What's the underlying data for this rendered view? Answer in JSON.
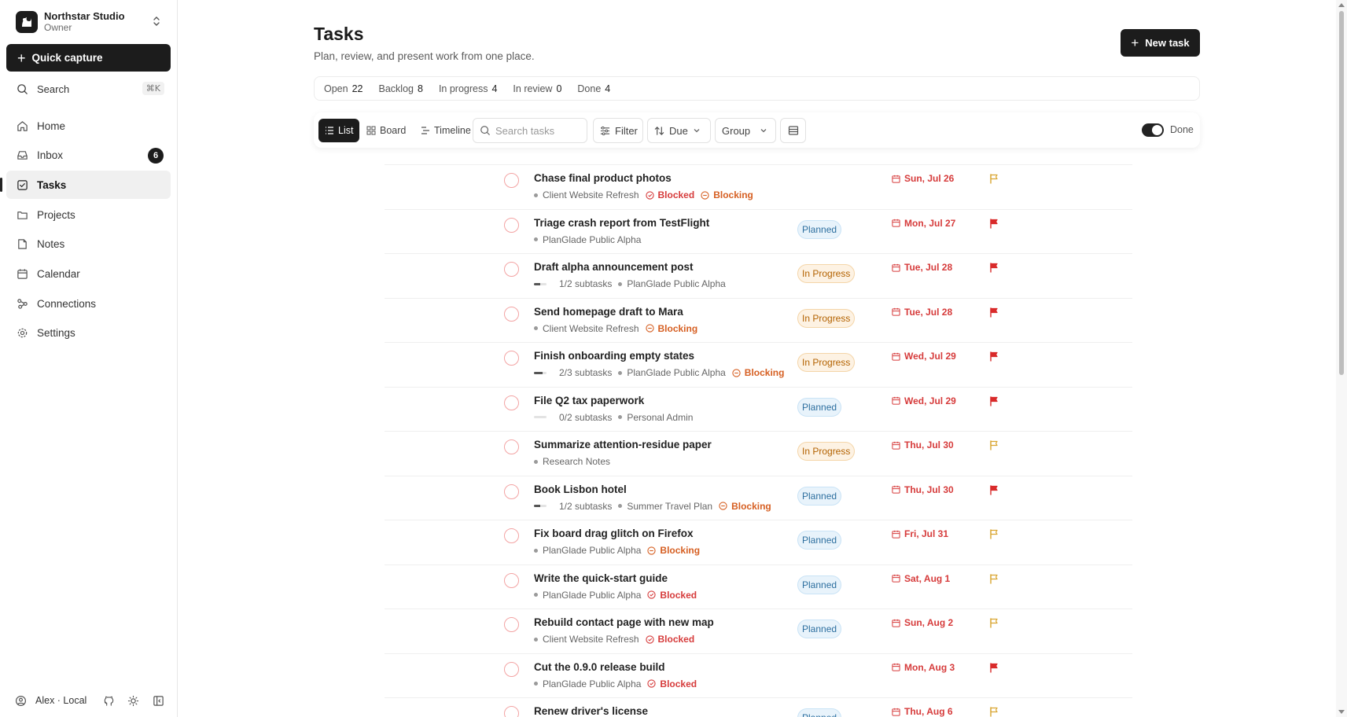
{
  "workspace": {
    "name": "Northstar Studio",
    "role": "Owner"
  },
  "quick_capture": {
    "label": "Quick capture"
  },
  "search": {
    "label": "Search",
    "shortcut": "⌘K"
  },
  "nav": [
    {
      "label": "Home",
      "icon": "home-icon"
    },
    {
      "label": "Inbox",
      "icon": "inbox-icon",
      "badge": "6"
    },
    {
      "label": "Tasks",
      "icon": "tasks-icon",
      "active": true
    },
    {
      "label": "Projects",
      "icon": "folder-icon"
    },
    {
      "label": "Notes",
      "icon": "note-icon"
    },
    {
      "label": "Calendar",
      "icon": "calendar-icon"
    },
    {
      "label": "Connections",
      "icon": "connections-icon"
    },
    {
      "label": "Settings",
      "icon": "gear-icon"
    }
  ],
  "footer": {
    "user": "Alex · Local"
  },
  "page": {
    "title": "Tasks",
    "subtitle": "Plan, review, and present work from one place.",
    "new_task": "New task"
  },
  "stats": [
    {
      "label": "Open",
      "value": "22"
    },
    {
      "label": "Backlog",
      "value": "8"
    },
    {
      "label": "In progress",
      "value": "4"
    },
    {
      "label": "In review",
      "value": "0"
    },
    {
      "label": "Done",
      "value": "4"
    }
  ],
  "toolbar": {
    "views": [
      "List",
      "Board",
      "Timeline"
    ],
    "search_placeholder": "Search tasks",
    "filter": "Filter",
    "sort": "Due",
    "group": "Group",
    "done_toggle": "Done"
  },
  "colors": {
    "accent": "#1c1c1c",
    "overdue": "#d63b3b",
    "blocking": "#d65f22",
    "planned": "#2d6f9f",
    "in_progress": "#b36200",
    "flag_high": "#d92b2b",
    "flag_normal": "#d9a531"
  },
  "tasks": [
    {
      "title": "Chase final product photos",
      "project": "Client Website Refresh",
      "blocked": "Blocked",
      "blocking": "Blocking",
      "status": "",
      "due": "Sun, Jul 26",
      "flag": "outline"
    },
    {
      "title": "Triage crash report from TestFlight",
      "project": "PlanGlade Public Alpha",
      "status": "Planned",
      "due": "Mon, Jul 27",
      "flag": "filled"
    },
    {
      "title": "Draft alpha announcement post",
      "subtasks": "1/2 subtasks",
      "subtask_progress": 0.5,
      "project": "PlanGlade Public Alpha",
      "status": "In Progress",
      "due": "Tue, Jul 28",
      "flag": "filled"
    },
    {
      "title": "Send homepage draft to Mara",
      "project": "Client Website Refresh",
      "blocking": "Blocking",
      "status": "In Progress",
      "due": "Tue, Jul 28",
      "flag": "filled"
    },
    {
      "title": "Finish onboarding empty states",
      "subtasks": "2/3 subtasks",
      "subtask_progress": 0.67,
      "project": "PlanGlade Public Alpha",
      "blocking": "Blocking",
      "status": "In Progress",
      "due": "Wed, Jul 29",
      "flag": "filled"
    },
    {
      "title": "File Q2 tax paperwork",
      "subtasks": "0/2 subtasks",
      "subtask_progress": 0,
      "project": "Personal Admin",
      "status": "Planned",
      "due": "Wed, Jul 29",
      "flag": "filled"
    },
    {
      "title": "Summarize attention-residue paper",
      "project": "Research Notes",
      "status": "In Progress",
      "due": "Thu, Jul 30",
      "flag": "outline"
    },
    {
      "title": "Book Lisbon hotel",
      "subtasks": "1/2 subtasks",
      "subtask_progress": 0.5,
      "project": "Summer Travel Plan",
      "blocking": "Blocking",
      "status": "Planned",
      "due": "Thu, Jul 30",
      "flag": "filled"
    },
    {
      "title": "Fix board drag glitch on Firefox",
      "project": "PlanGlade Public Alpha",
      "blocking": "Blocking",
      "status": "Planned",
      "due": "Fri, Jul 31",
      "flag": "outline"
    },
    {
      "title": "Write the quick-start guide",
      "project": "PlanGlade Public Alpha",
      "blocked": "Blocked",
      "status": "Planned",
      "due": "Sat, Aug 1",
      "flag": "outline"
    },
    {
      "title": "Rebuild contact page with new map",
      "project": "Client Website Refresh",
      "blocked": "Blocked",
      "status": "Planned",
      "due": "Sun, Aug 2",
      "flag": "outline"
    },
    {
      "title": "Cut the 0.9.0 release build",
      "project": "PlanGlade Public Alpha",
      "blocked": "Blocked",
      "status": "",
      "due": "Mon, Aug 3",
      "flag": "filled"
    },
    {
      "title": "Renew driver's license",
      "status": "Planned",
      "due": "Thu, Aug 6",
      "flag": "outline"
    }
  ]
}
